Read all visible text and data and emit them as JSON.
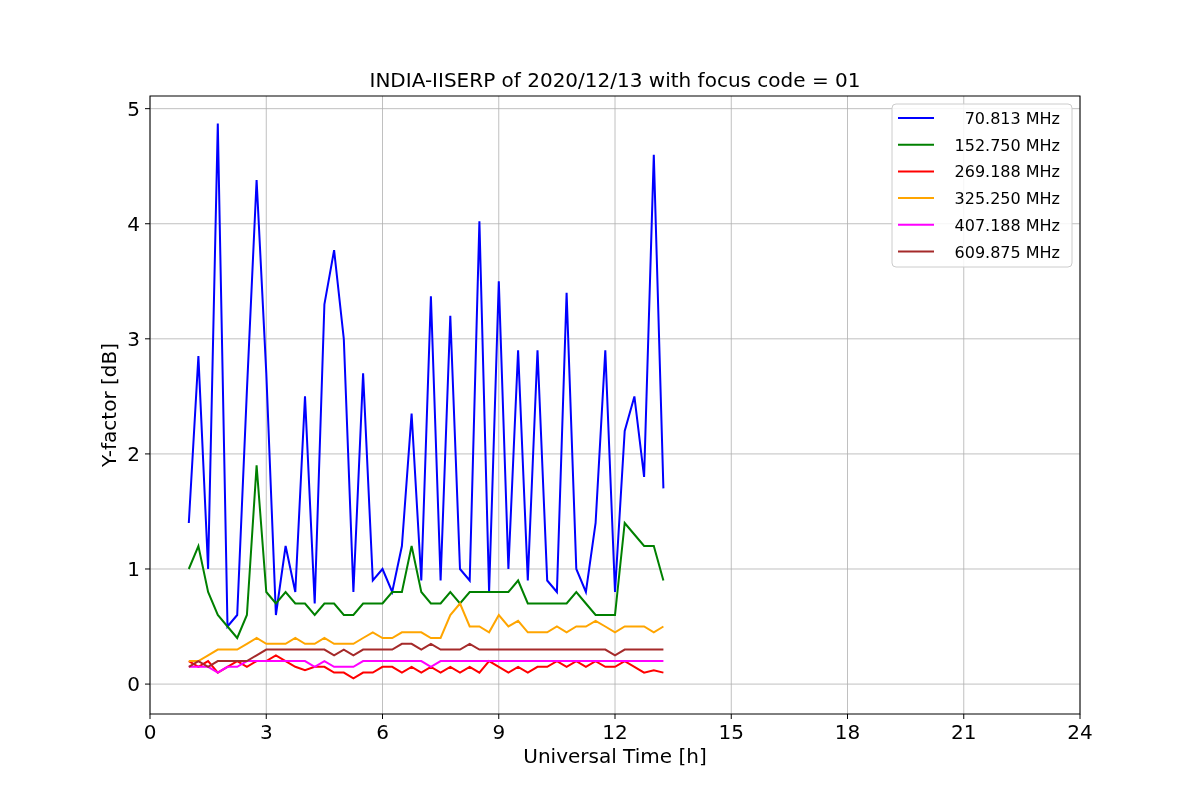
{
  "chart_data": {
    "type": "line",
    "title": "INDIA-IISERP of 2020/12/13 with focus code = 01",
    "xlabel": "Universal Time [h]",
    "ylabel": "Y-factor [dB]",
    "xlim": [
      0,
      24
    ],
    "ylim": [
      -0.26,
      5.11
    ],
    "grid": true,
    "legend": true,
    "xticks": [
      0,
      3,
      6,
      9,
      12,
      15,
      18,
      21,
      24
    ],
    "yticks": [
      0,
      1,
      2,
      3,
      4,
      5
    ],
    "x": [
      1.0,
      1.25,
      1.5,
      1.75,
      2.0,
      2.25,
      2.5,
      2.75,
      3.0,
      3.25,
      3.5,
      3.75,
      4.0,
      4.25,
      4.5,
      4.75,
      5.0,
      5.25,
      5.5,
      5.75,
      6.0,
      6.25,
      6.5,
      6.75,
      7.0,
      7.25,
      7.5,
      7.75,
      8.0,
      8.25,
      8.5,
      8.75,
      9.0,
      9.25,
      9.5,
      9.75,
      10.0,
      10.25,
      10.5,
      10.75,
      11.0,
      11.25,
      11.5,
      11.75,
      12.0,
      12.25,
      12.5,
      12.75,
      13.0,
      13.25
    ],
    "series": [
      {
        "name": "70.813 MHz",
        "color": "#0000ff",
        "values": [
          1.4,
          2.85,
          1.0,
          4.87,
          0.5,
          0.6,
          2.55,
          4.38,
          2.7,
          0.6,
          1.2,
          0.8,
          2.5,
          0.7,
          3.3,
          3.77,
          3.0,
          0.8,
          2.7,
          0.9,
          1.0,
          0.8,
          1.2,
          2.35,
          0.9,
          3.37,
          0.9,
          3.2,
          1.0,
          0.9,
          4.02,
          0.8,
          3.5,
          1.0,
          2.9,
          0.9,
          2.9,
          0.9,
          0.8,
          3.4,
          1.0,
          0.8,
          1.4,
          2.9,
          0.8,
          2.2,
          2.5,
          1.8,
          4.6,
          1.7
        ]
      },
      {
        "name": "152.750 MHz",
        "color": "#008000",
        "values": [
          1.0,
          1.2,
          0.8,
          0.6,
          0.5,
          0.4,
          0.6,
          1.9,
          0.8,
          0.7,
          0.8,
          0.7,
          0.7,
          0.6,
          0.7,
          0.7,
          0.6,
          0.6,
          0.7,
          0.7,
          0.7,
          0.8,
          0.8,
          1.2,
          0.8,
          0.7,
          0.7,
          0.8,
          0.7,
          0.8,
          0.8,
          0.8,
          0.8,
          0.8,
          0.9,
          0.7,
          0.7,
          0.7,
          0.7,
          0.7,
          0.8,
          0.7,
          0.6,
          0.6,
          0.6,
          1.4,
          1.3,
          1.2,
          1.2,
          0.9
        ]
      },
      {
        "name": "269.188 MHz",
        "color": "#ff0000",
        "values": [
          0.2,
          0.15,
          0.2,
          0.1,
          0.15,
          0.2,
          0.15,
          0.2,
          0.2,
          0.25,
          0.2,
          0.15,
          0.12,
          0.15,
          0.15,
          0.1,
          0.1,
          0.05,
          0.1,
          0.1,
          0.15,
          0.15,
          0.1,
          0.15,
          0.1,
          0.15,
          0.1,
          0.15,
          0.1,
          0.15,
          0.1,
          0.2,
          0.15,
          0.1,
          0.15,
          0.1,
          0.15,
          0.15,
          0.2,
          0.15,
          0.2,
          0.15,
          0.2,
          0.15,
          0.15,
          0.2,
          0.15,
          0.1,
          0.12,
          0.1
        ]
      },
      {
        "name": "325.250 MHz",
        "color": "#ffa500",
        "values": [
          0.2,
          0.2,
          0.25,
          0.3,
          0.3,
          0.3,
          0.35,
          0.4,
          0.35,
          0.35,
          0.35,
          0.4,
          0.35,
          0.35,
          0.4,
          0.35,
          0.35,
          0.35,
          0.4,
          0.45,
          0.4,
          0.4,
          0.45,
          0.45,
          0.45,
          0.4,
          0.4,
          0.6,
          0.7,
          0.5,
          0.5,
          0.45,
          0.6,
          0.5,
          0.55,
          0.45,
          0.45,
          0.45,
          0.5,
          0.45,
          0.5,
          0.5,
          0.55,
          0.5,
          0.45,
          0.5,
          0.5,
          0.5,
          0.45,
          0.5
        ]
      },
      {
        "name": "407.188 MHz",
        "color": "#ff00ff",
        "values": [
          0.15,
          0.15,
          0.15,
          0.1,
          0.15,
          0.15,
          0.2,
          0.2,
          0.2,
          0.2,
          0.2,
          0.2,
          0.2,
          0.15,
          0.2,
          0.15,
          0.15,
          0.15,
          0.2,
          0.2,
          0.2,
          0.2,
          0.2,
          0.2,
          0.2,
          0.15,
          0.2,
          0.2,
          0.2,
          0.2,
          0.2,
          0.2,
          0.2,
          0.2,
          0.2,
          0.2,
          0.2,
          0.2,
          0.2,
          0.2,
          0.2,
          0.2,
          0.2,
          0.2,
          0.2,
          0.2,
          0.2,
          0.2,
          0.2,
          0.2
        ]
      },
      {
        "name": "609.875 MHz",
        "color": "#a52a2a",
        "values": [
          0.15,
          0.2,
          0.15,
          0.2,
          0.2,
          0.2,
          0.2,
          0.25,
          0.3,
          0.3,
          0.3,
          0.3,
          0.3,
          0.3,
          0.3,
          0.25,
          0.3,
          0.25,
          0.3,
          0.3,
          0.3,
          0.3,
          0.35,
          0.35,
          0.3,
          0.35,
          0.3,
          0.3,
          0.3,
          0.35,
          0.3,
          0.3,
          0.3,
          0.3,
          0.3,
          0.3,
          0.3,
          0.3,
          0.3,
          0.3,
          0.3,
          0.3,
          0.3,
          0.3,
          0.25,
          0.3,
          0.3,
          0.3,
          0.3,
          0.3
        ]
      }
    ]
  }
}
